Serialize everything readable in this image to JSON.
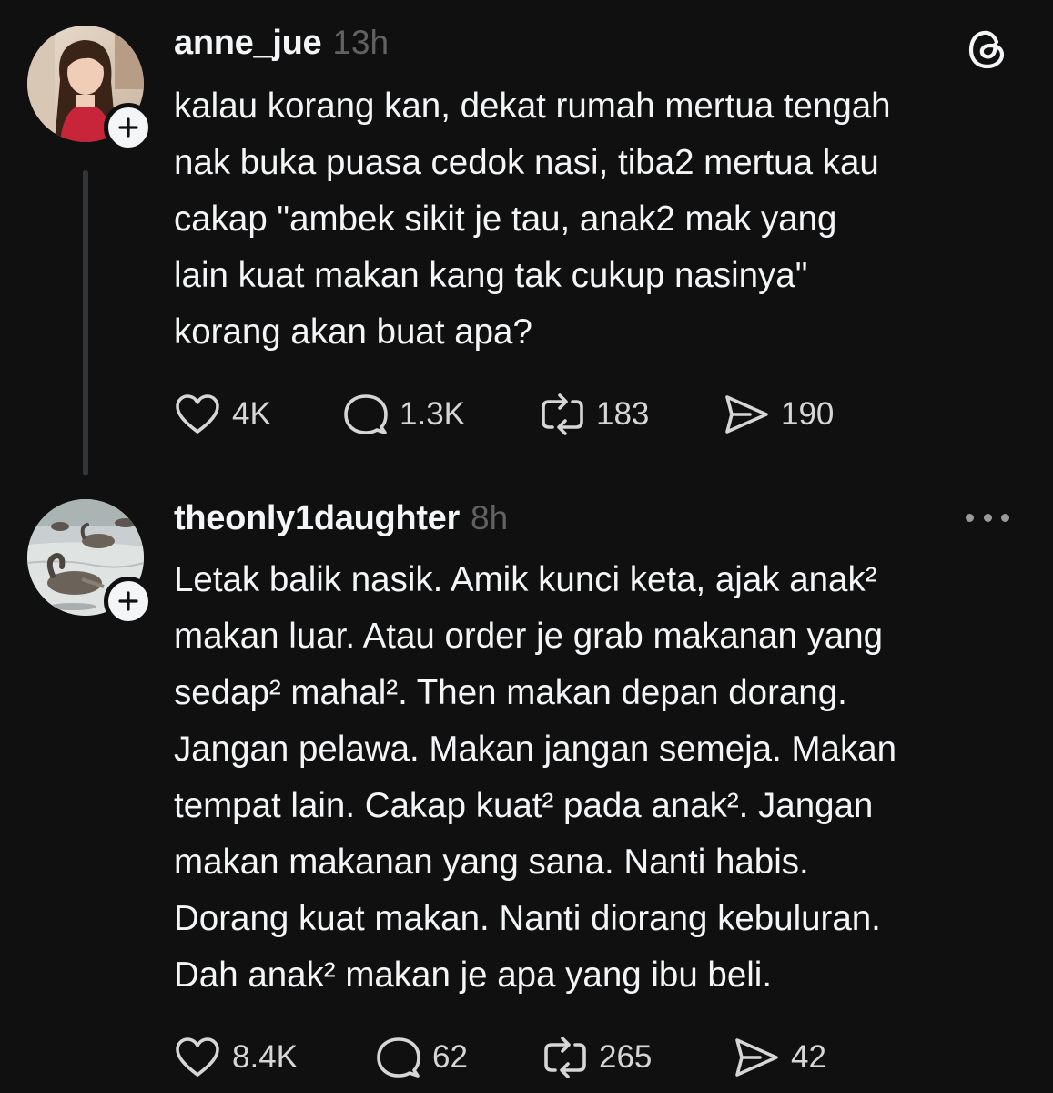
{
  "colors": {
    "background": "#101010",
    "primary_text": "#f3f5f7",
    "secondary_text": "#616161",
    "thread_line": "#333638"
  },
  "posts": [
    {
      "username": "anne_jue",
      "time": "13h",
      "corner_icon": "threads-logo-icon",
      "lines": [
        "kalau korang kan, dekat rumah mertua tengah",
        "nak buka puasa cedok nasi, tiba2 mertua kau",
        "cakap \"ambek sikit je tau, anak2 mak yang",
        "lain kuat makan kang tak cukup nasinya\"",
        "korang akan buat apa?"
      ],
      "stats": {
        "likes": "4K",
        "replies": "1.3K",
        "reposts": "183",
        "shares": "190"
      }
    },
    {
      "username": "theonly1daughter",
      "time": "8h",
      "corner_icon": "more-options-icon",
      "lines": [
        "Letak balik nasik. Amik kunci keta, ajak anak²",
        "makan luar. Atau order je grab makanan yang",
        "sedap² mahal². Then makan depan dorang.",
        "Jangan pelawa. Makan jangan semeja. Makan",
        "tempat lain. Cakap kuat² pada anak². Jangan",
        "makan makanan yang sana. Nanti habis.",
        "Dorang kuat makan. Nanti diorang kebuluran.",
        "Dah anak² makan je apa yang ibu beli."
      ],
      "stats": {
        "likes": "8.4K",
        "replies": "62",
        "reposts": "265",
        "shares": "42"
      }
    }
  ]
}
